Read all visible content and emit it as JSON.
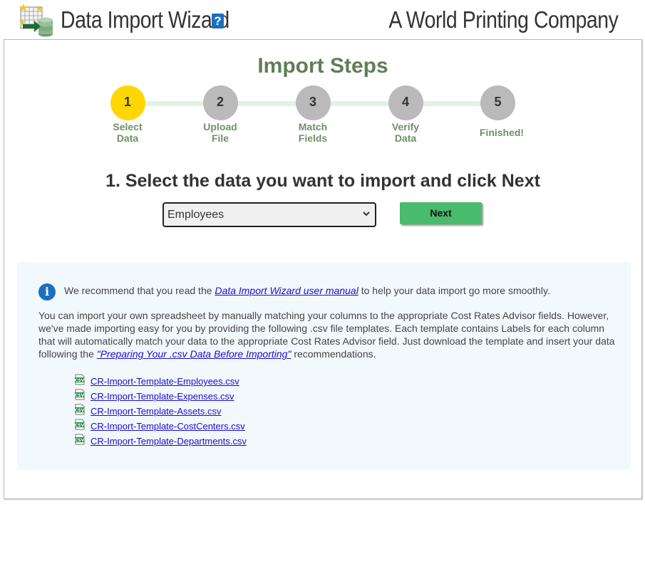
{
  "header": {
    "app_title": "Data Import Wizard",
    "help_icon": "?",
    "company_name": "A World Printing Company"
  },
  "steps": {
    "title": "Import Steps",
    "current": 1,
    "items": [
      {
        "number": "1",
        "label_line1": "Select",
        "label_line2": "Data",
        "status": "active"
      },
      {
        "number": "2",
        "label_line1": "Upload",
        "label_line2": "File",
        "status": "pending"
      },
      {
        "number": "3",
        "label_line1": "Match",
        "label_line2": "Fields",
        "status": "pending"
      },
      {
        "number": "4",
        "label_line1": "Verify",
        "label_line2": "Data",
        "status": "pending"
      },
      {
        "number": "5",
        "label_line1": "",
        "label_line2": "Finished!",
        "status": "pending"
      }
    ]
  },
  "main": {
    "instruction": "1. Select the data you want to import and click Next",
    "data_select": {
      "selected": "Employees"
    },
    "next_label": "Next"
  },
  "info": {
    "icon": "i",
    "recommend_prefix": "We recommend that you read the ",
    "manual_link": "Data Import Wizard user manual",
    "recommend_suffix": " to help your data import go more smoothly.",
    "desc_text": "You can import your own spreadsheet by manually matching your columns to the appropriate Cost Rates Advisor fields. However, we've made importing easy for you by providing the following .csv file templates. Each template contains Labels for each column that will automatically match your data to the appropriate Cost Rates Advisor field. Just download the template and insert your data following the ",
    "prep_link": "\"Preparing Your .csv Data Before Importing\"",
    "desc_suffix": " recommendations.",
    "templates": [
      "CR-Import-Template-Employees.csv",
      "CR-Import-Template-Expenses.csv",
      "CR-Import-Template-Assets.csv",
      "CR-Import-Template-CostCenters.csv",
      "CR-Import-Template-Departments.csv"
    ]
  },
  "colors": {
    "active_step": "#ffd700",
    "pending_step": "#bababa",
    "title_green": "#5e7e57",
    "next_button": "#48bb6c",
    "info_bg": "#f2f9fd",
    "link": "#1a0dcc"
  }
}
